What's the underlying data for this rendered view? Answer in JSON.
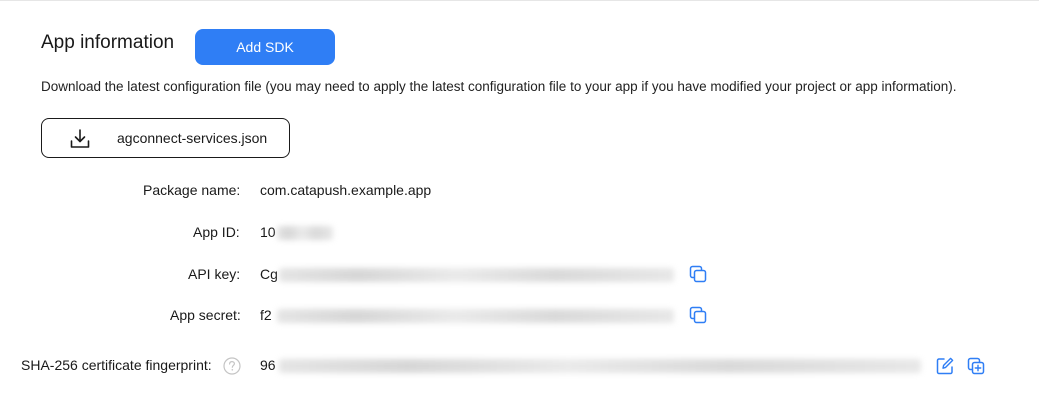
{
  "header": {
    "title": "App information",
    "add_sdk_label": "Add SDK"
  },
  "description": "Download the latest configuration file (you may need to apply the latest configuration file to your app if you have modified your project or app information).",
  "download": {
    "file_label": "agconnect-services.json",
    "icon": "download-icon"
  },
  "fields": {
    "package_name": {
      "label": "Package name:",
      "value": "com.catapush.example.app"
    },
    "app_id": {
      "label": "App ID:",
      "value_prefix": "10"
    },
    "api_key": {
      "label": "API key:",
      "value_prefix": "Cg"
    },
    "app_secret": {
      "label": "App secret:",
      "value_prefix": "f2"
    },
    "sha256": {
      "label": "SHA-256 certificate fingerprint:",
      "value_prefix": "96"
    }
  },
  "icons": {
    "copy": "copy-icon",
    "edit": "edit-icon",
    "add": "add-icon",
    "help": "help-icon"
  },
  "colors": {
    "accent": "#2f7ef5",
    "icon_blue": "#2f7ef5"
  }
}
